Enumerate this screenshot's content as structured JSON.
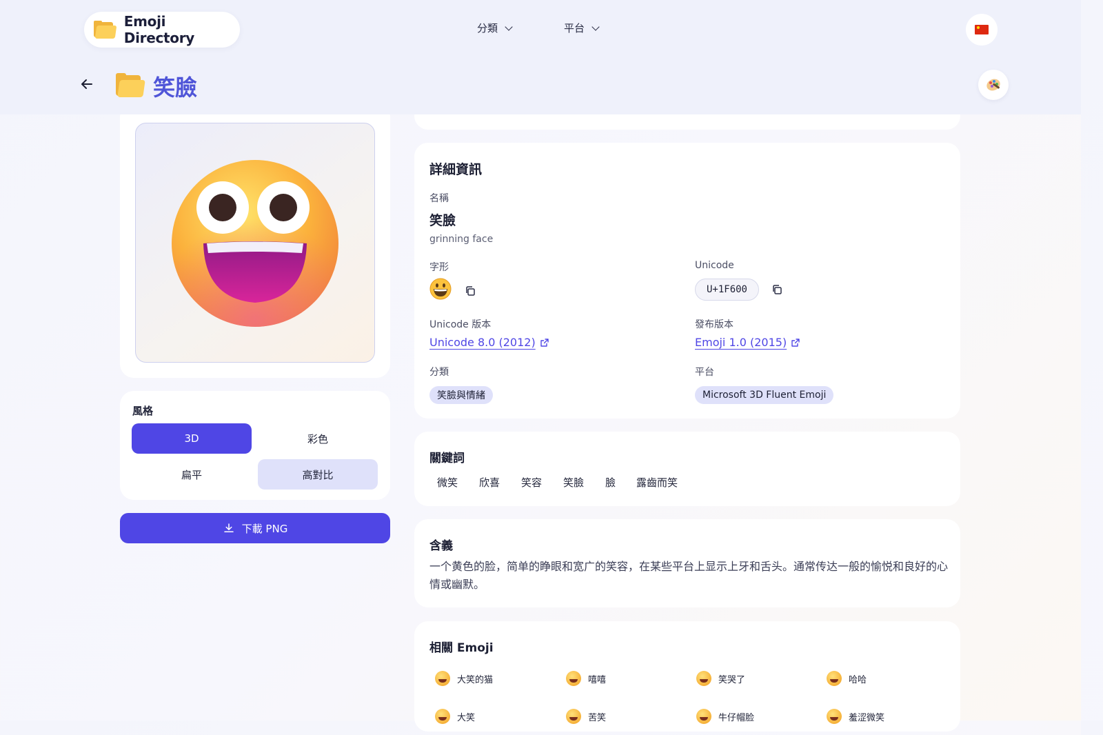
{
  "header": {
    "logo_text": "Emoji Directory",
    "nav": [
      {
        "label": "分類"
      },
      {
        "label": "平台"
      }
    ],
    "page_title": "笑臉"
  },
  "style_panel": {
    "label": "風格",
    "options": [
      "3D",
      "彩色",
      "扁平",
      "高對比"
    ],
    "selected": "3D",
    "download_label": "下載 PNG"
  },
  "details": {
    "title": "詳細資訊",
    "name_label": "名稱",
    "name": "笑臉",
    "name_en": "grinning face",
    "glyph_label": "字形",
    "unicode_label": "Unicode",
    "unicode_value": "U+1F600",
    "unicode_version_label": "Unicode 版本",
    "unicode_version": "Unicode 8.0 (2012)",
    "release_label": "發布版本",
    "release_version": "Emoji 1.0 (2015)",
    "category_label": "分類",
    "category": "笑臉與情緒",
    "platform_label": "平台",
    "platform": "Microsoft 3D Fluent Emoji"
  },
  "keywords": {
    "title": "關鍵詞",
    "items": [
      "微笑",
      "欣喜",
      "笑容",
      "笑臉",
      "臉",
      "露齒而笑"
    ]
  },
  "meaning": {
    "title": "含義",
    "text": "一个黄色的脸，简单的睁眼和宽广的笑容，在某些平台上显示上牙和舌头。通常传达一般的愉悦和良好的心情或幽默。"
  },
  "related": {
    "title": "相關 Emoji",
    "items": [
      "大笑的猫",
      "嘻嘻",
      "笑哭了",
      "哈哈",
      "大笑",
      "苦笑",
      "牛仔帽脸",
      "羞涩微笑"
    ]
  },
  "colors": {
    "accent": "#4f46e5",
    "title_accent": "#4f55d8",
    "chip_bg": "#dfe1fa"
  }
}
